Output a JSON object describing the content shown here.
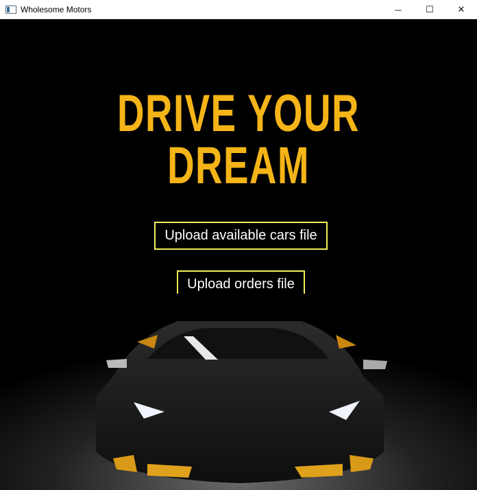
{
  "window": {
    "title": "Wholesome Motors",
    "controls": [
      "─",
      "☐",
      "✕"
    ]
  },
  "hero": {
    "headline": "DRIVE YOUR DREAM"
  },
  "buttons": {
    "upload_cars": "Upload available cars file",
    "upload_orders": "Upload orders file"
  },
  "colors": {
    "headline": "#f5b417",
    "button_border": "#f3ef5a",
    "background": "#000000"
  }
}
